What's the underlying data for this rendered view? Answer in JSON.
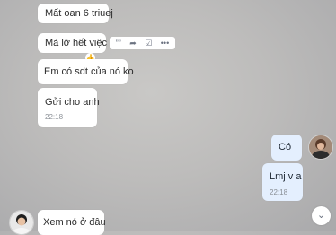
{
  "messages": [
    {
      "text": "Mất oan 6 triuej"
    },
    {
      "text": "Mà lỡ hết việc"
    },
    {
      "text": "Em có sdt của nó ko"
    },
    {
      "text": "Gửi cho anh",
      "time": "22:18"
    },
    {
      "text": "Có"
    },
    {
      "text": "Lmj v a",
      "time": "22:18"
    },
    {
      "text": "Xem nó ở đâu"
    }
  ],
  "toolbar": {
    "quote_icon": "””",
    "forward_icon": "➦",
    "task_icon": "☑",
    "more_icon": "•••"
  },
  "like_icon": "👍",
  "scroll_down_icon": "⌄"
}
